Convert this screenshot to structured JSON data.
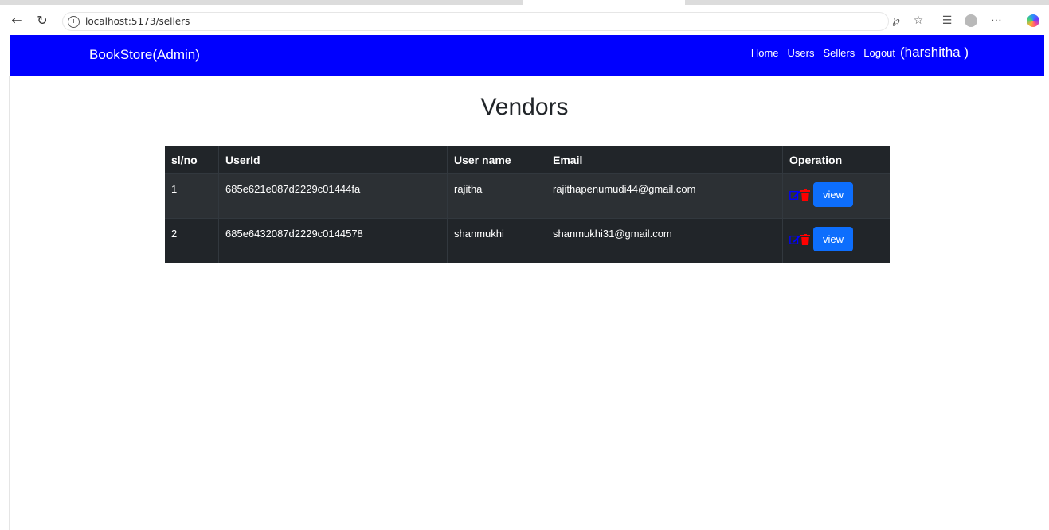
{
  "browser": {
    "url": "localhost:5173/sellers",
    "info_glyph": "i"
  },
  "nav": {
    "brand": "BookStore(Admin)",
    "links": [
      "Home",
      "Users",
      "Sellers",
      "Logout"
    ],
    "user": "(harshitha )"
  },
  "page": {
    "title": "Vendors"
  },
  "table": {
    "headers": [
      "sl/no",
      "UserId",
      "User name",
      "Email",
      "Operation"
    ],
    "rows": [
      {
        "sl": "1",
        "id": "685e621e087d2229c01444fa",
        "name": "rajitha",
        "email": "rajithapenumudi44@gmail.com",
        "button": "view"
      },
      {
        "sl": "2",
        "id": "685e6432087d2229c0144578",
        "name": "shanmukhi",
        "email": "shanmukhi31@gmail.com",
        "button": "view"
      }
    ]
  },
  "colors": {
    "nav_bg": "#0000ff",
    "table_bg": "#212529",
    "button_bg": "#0d6efd",
    "delete_icon": "#ff0000",
    "edit_icon": "#0000ff"
  },
  "icons": [
    "back-arrow-icon",
    "reload-icon",
    "info-icon",
    "read-aloud-icon",
    "favorite-star-icon",
    "favorites-list-icon",
    "profile-icon",
    "more-icon",
    "copilot-icon",
    "edit-icon",
    "trash-icon"
  ]
}
